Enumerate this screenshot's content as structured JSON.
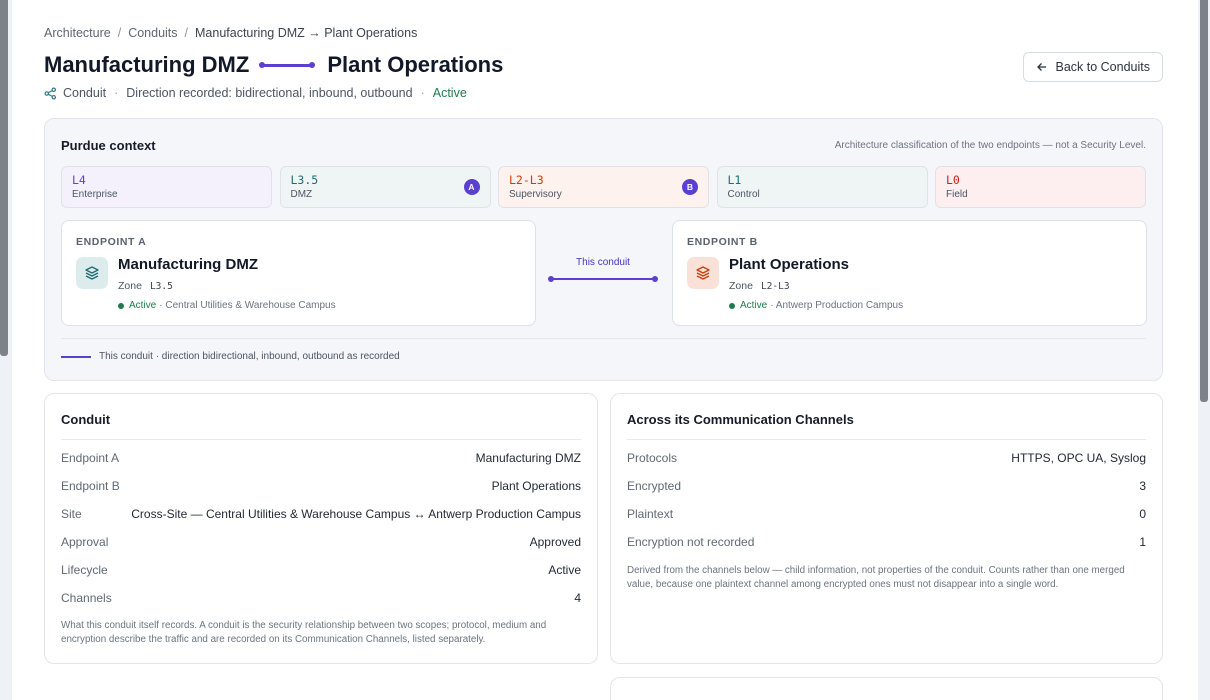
{
  "breadcrumb": {
    "items": [
      "Architecture",
      "Conduits",
      "Manufacturing DMZ → Plant Operations"
    ],
    "separator": "/"
  },
  "title": {
    "left": "Manufacturing DMZ",
    "right": "Plant Operations"
  },
  "meta": {
    "type": "Conduit",
    "direction": "Direction recorded: bidirectional, inbound, outbound",
    "status": "Active",
    "separator": "·"
  },
  "back_button": {
    "label": "Back to Conduits"
  },
  "purdue": {
    "heading": "Purdue context",
    "note": "Architecture classification of the two endpoints — not a Security Level.",
    "levels": [
      {
        "code": "L4",
        "name": "Enterprise",
        "badge": "",
        "color": "#5b3fd1",
        "bg": "#f4f1fd"
      },
      {
        "code": "L3.5",
        "name": "DMZ",
        "badge": "A",
        "color": "#1d6b73",
        "bg": "#eff5f5"
      },
      {
        "code": "L2-L3",
        "name": "Supervisory",
        "badge": "B",
        "color": "#c2410c",
        "bg": "#fdf2ee"
      },
      {
        "code": "L1",
        "name": "Control",
        "badge": "",
        "color": "#1d6b73",
        "bg": "#eff5f4"
      },
      {
        "code": "L0",
        "name": "Field",
        "badge": "",
        "color": "#c81e1e",
        "bg": "#fdeff0"
      }
    ],
    "endpoint_a": {
      "label": "ENDPOINT A",
      "name": "Manufacturing DMZ",
      "zone_label": "Zone",
      "zone": "L3.5",
      "status": "Active",
      "site": "· Central Utilities & Warehouse Campus",
      "icon": "layers-icon",
      "icon_color": "#1d6b73",
      "icon_bg": "#dcebec"
    },
    "endpoint_b": {
      "label": "ENDPOINT B",
      "name": "Plant Operations",
      "zone_label": "Zone",
      "zone": "L2-L3",
      "status": "Active",
      "site": "· Antwerp Production Campus",
      "icon": "layers-icon",
      "icon_color": "#c2410c",
      "icon_bg": "#f9e1d7"
    },
    "conduit_label": "This conduit",
    "legend": "This conduit · direction bidirectional, inbound, outbound as recorded"
  },
  "conduit_card": {
    "heading": "Conduit",
    "rows": [
      {
        "key": "Endpoint A",
        "value": "Manufacturing DMZ"
      },
      {
        "key": "Endpoint B",
        "value": "Plant Operations"
      },
      {
        "key": "Site",
        "value": "Cross-Site — Central Utilities & Warehouse Campus ↔ Antwerp Production Campus"
      },
      {
        "key": "Approval",
        "value": "Approved"
      },
      {
        "key": "Lifecycle",
        "value": "Active"
      },
      {
        "key": "Channels",
        "value": "4"
      }
    ],
    "footnote": "What this conduit itself records. A conduit is the security relationship between two scopes; protocol, medium and encryption describe the traffic and are recorded on its Communication Channels, listed separately."
  },
  "channels_card": {
    "heading": "Across its Communication Channels",
    "rows": [
      {
        "key": "Protocols",
        "value": "HTTPS, OPC UA, Syslog"
      },
      {
        "key": "Encrypted",
        "value": "3"
      },
      {
        "key": "Plaintext",
        "value": "0"
      },
      {
        "key": "Encryption not recorded",
        "value": "1"
      }
    ],
    "footnote": "Derived from the channels below — child information, not properties of the conduit. Counts rather than one merged value, because one plaintext channel among encrypted ones must not disappear into a single word."
  },
  "accent": "#5b3fd1"
}
